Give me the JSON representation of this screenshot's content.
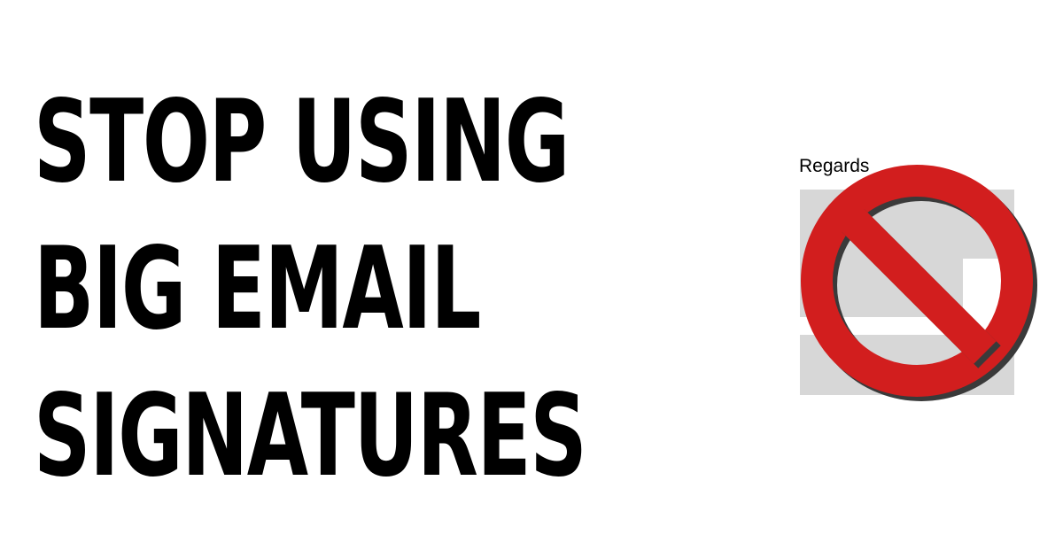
{
  "headline": {
    "lines": [
      "STOP USING",
      "BIG EMAIL",
      "SIGNATURES"
    ]
  },
  "illustration": {
    "greeting": "Regards",
    "icon": "prohibited-icon",
    "colors": {
      "prohibit_red": "#d21e1e",
      "shadow": "#3a3a3a",
      "placeholder_gray": "#d7d7d7"
    }
  }
}
